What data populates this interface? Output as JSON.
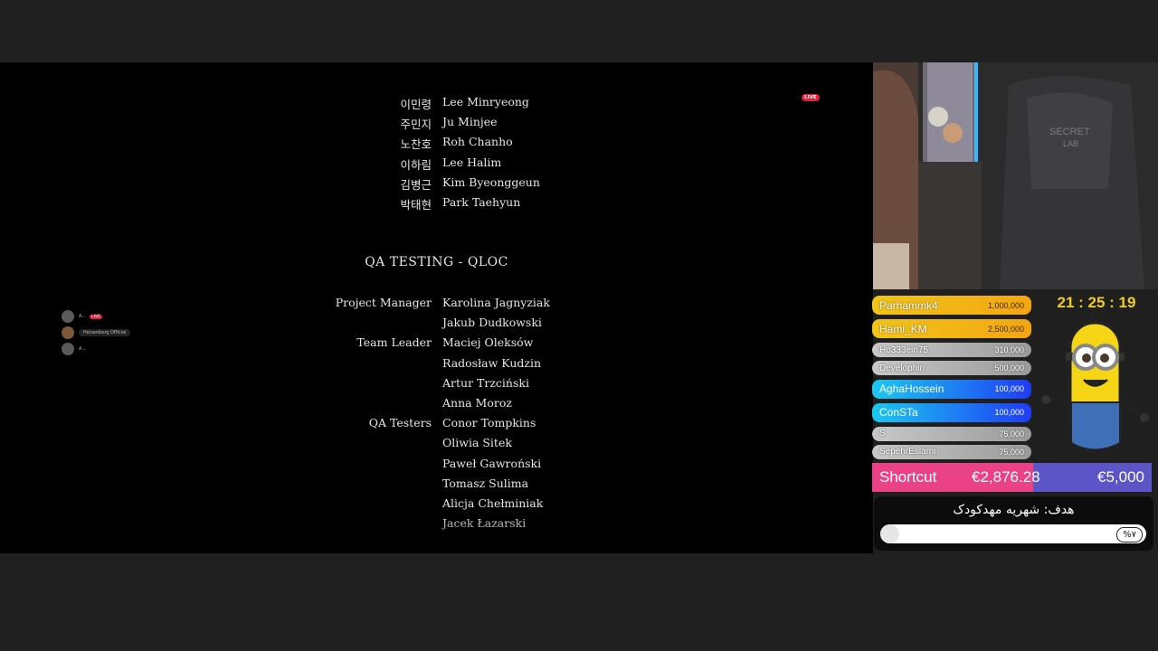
{
  "stream": {
    "live_badge": "LIVE"
  },
  "credits": {
    "korean_rows": [
      {
        "kr": "이민령",
        "name": "Lee Minryeong"
      },
      {
        "kr": "주민지",
        "name": "Ju Minjee"
      },
      {
        "kr": "노찬호",
        "name": "Roh Chanho"
      },
      {
        "kr": "이하림",
        "name": "Lee Halim"
      },
      {
        "kr": "김병근",
        "name": "Kim Byeonggeun"
      },
      {
        "kr": "박태현",
        "name": "Park Taehyun"
      }
    ],
    "section_title": "QA TESTING - QLOC",
    "qa_rows": [
      {
        "role": "Project Manager",
        "name": "Karolina Jagnyziak"
      },
      {
        "role": "",
        "name": "Jakub Dudkowski"
      },
      {
        "role": "Team Leader",
        "name": "Maciej Oleksów"
      },
      {
        "role": "",
        "name": "Radosław Kudzin"
      },
      {
        "role": "",
        "name": "Artur Trzciński"
      },
      {
        "role": "",
        "name": "Anna Moroz"
      },
      {
        "role": "QA Testers",
        "name": "Conor Tompkins"
      },
      {
        "role": "",
        "name": "Oliwia Sitek"
      },
      {
        "role": "",
        "name": "Paweł Gawroński"
      },
      {
        "role": "",
        "name": "Tomasz Sulima"
      },
      {
        "role": "",
        "name": "Alicja Chełminiak"
      },
      {
        "role": "",
        "name": "Jacek Łazarski"
      }
    ]
  },
  "mini_chat": {
    "row1": "A...",
    "row1_live": "LIVE",
    "row2": "Heisenberg Official",
    "row3": "A..."
  },
  "leaderboard": [
    {
      "name": "Parhammk4",
      "amount": "1,000,000",
      "tier": "gold"
    },
    {
      "name": "Hami_KM",
      "amount": "2,500,000",
      "tier": "gold"
    },
    {
      "name": "Ho333ein75",
      "amount": "310,000",
      "tier": "grey"
    },
    {
      "name": "Develophin",
      "amount": "500,000",
      "tier": "grey"
    },
    {
      "name": "AghaHossein",
      "amount": "100,000",
      "tier": "blue"
    },
    {
      "name": "ConSTa",
      "amount": "100,000",
      "tier": "blue"
    },
    {
      "name": "S",
      "amount": "75,000",
      "tier": "grey"
    },
    {
      "name": "SepehrEslami",
      "amount": "75,000",
      "tier": "grey"
    }
  ],
  "clock": "21 : 25 : 19",
  "goal": {
    "label": "Shortcut",
    "current": "€2,876.28",
    "target": "€5,000",
    "progress": 0.575
  },
  "target": {
    "title": "هدف: شهریه مهدکودک",
    "percent": "%۷",
    "progress": 0.07
  },
  "colors": {
    "gold": "#f0c419",
    "blue": "#1f3cf5",
    "pink": "#ea4187",
    "purple": "#5b55c8",
    "clock": "#f3cd22"
  }
}
